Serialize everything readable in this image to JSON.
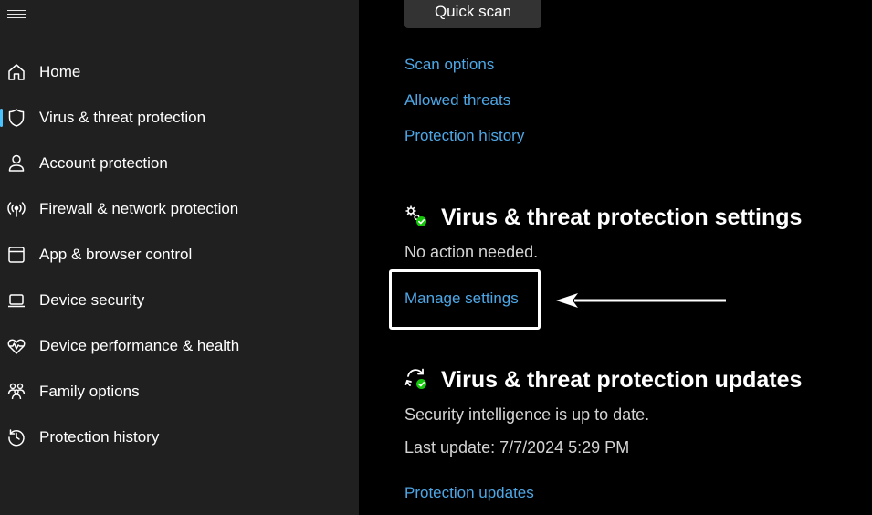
{
  "sidebar": {
    "menu_icon": "hamburger-menu-icon",
    "items": [
      {
        "label": "Home",
        "icon": "home-icon",
        "active": false
      },
      {
        "label": "Virus & threat protection",
        "icon": "shield-icon",
        "active": true
      },
      {
        "label": "Account protection",
        "icon": "person-icon",
        "active": false
      },
      {
        "label": "Firewall & network protection",
        "icon": "wifi-signal-icon",
        "active": false
      },
      {
        "label": "App & browser control",
        "icon": "app-window-icon",
        "active": false
      },
      {
        "label": "Device security",
        "icon": "laptop-icon",
        "active": false
      },
      {
        "label": "Device performance & health",
        "icon": "heart-pulse-icon",
        "active": false
      },
      {
        "label": "Family options",
        "icon": "family-icon",
        "active": false
      },
      {
        "label": "Protection history",
        "icon": "history-icon",
        "active": false
      }
    ]
  },
  "main": {
    "quick_scan_label": "Quick scan",
    "links": {
      "scan_options": "Scan options",
      "allowed_threats": "Allowed threats",
      "protection_history": "Protection history"
    },
    "settings_section": {
      "icon": "gear-check-icon",
      "title": "Virus & threat protection settings",
      "status": "No action needed.",
      "manage_link": "Manage settings"
    },
    "updates_section": {
      "icon": "refresh-check-icon",
      "title": "Virus & threat protection updates",
      "status": "Security intelligence is up to date.",
      "last_update": "Last update: 7/7/2024 5:29 PM",
      "updates_link": "Protection updates"
    }
  },
  "annotation": {
    "box_color": "#ffffff",
    "arrow_color": "#ffffff"
  },
  "colors": {
    "sidebar_bg": "#202020",
    "main_bg": "#000000",
    "link": "#4ea7e6",
    "accent": "#4cc2ff",
    "check_green": "#16c60c"
  }
}
